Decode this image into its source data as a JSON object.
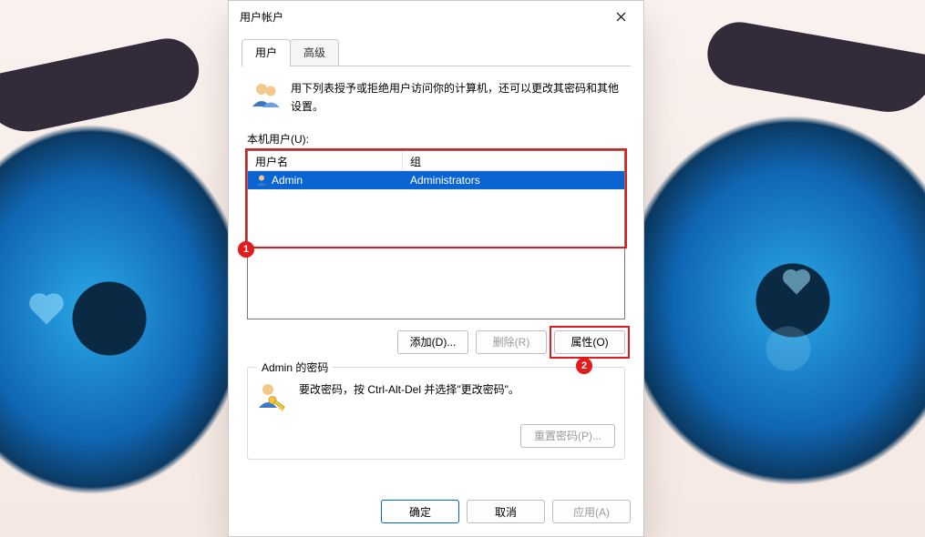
{
  "window": {
    "title": "用户帐户"
  },
  "tabs": {
    "users": "用户",
    "advanced": "高级"
  },
  "intro": "用下列表授予或拒绝用户访问你的计算机，还可以更改其密码和其他设置。",
  "labels": {
    "local_users": "本机用户(U):",
    "col_user": "用户名",
    "col_group": "组"
  },
  "users": [
    {
      "name": "Admin",
      "group": "Administrators"
    }
  ],
  "buttons": {
    "add": "添加(D)...",
    "remove": "删除(R)",
    "properties": "属性(O)",
    "reset_pw": "重置密码(P)...",
    "ok": "确定",
    "cancel": "取消",
    "apply": "应用(A)"
  },
  "password_group": {
    "legend": "Admin 的密码",
    "text": "要改密码，按 Ctrl-Alt-Del 并选择\"更改密码\"。"
  },
  "callouts": {
    "one": "1",
    "two": "2"
  }
}
